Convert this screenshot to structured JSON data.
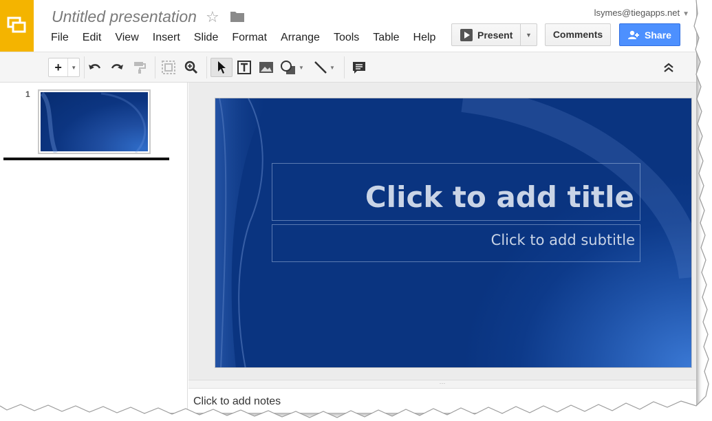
{
  "app": {
    "title": "Untitled presentation",
    "user_email": "lsymes@tiegapps.net",
    "logo_color": "#f4b400"
  },
  "menu": [
    "File",
    "Edit",
    "View",
    "Insert",
    "Slide",
    "Format",
    "Arrange",
    "Tools",
    "Table",
    "Help"
  ],
  "buttons": {
    "present": "Present",
    "comments": "Comments",
    "share": "Share",
    "share_color": "#4d90fe"
  },
  "toolbar": {
    "icons": [
      "plus-icon",
      "undo-icon",
      "redo-icon",
      "paint-format-icon",
      "fit-icon",
      "zoom-icon",
      "select-icon",
      "text-box-icon",
      "image-icon",
      "shape-icon",
      "line-icon",
      "comment-icon",
      "collapse-icon"
    ]
  },
  "filmstrip": {
    "slides": [
      {
        "number": "1"
      }
    ]
  },
  "slide": {
    "title_placeholder": "Click to add title",
    "subtitle_placeholder": "Click to add subtitle",
    "background_color": "#0a3480"
  },
  "notes": {
    "placeholder": "Click to add notes"
  }
}
